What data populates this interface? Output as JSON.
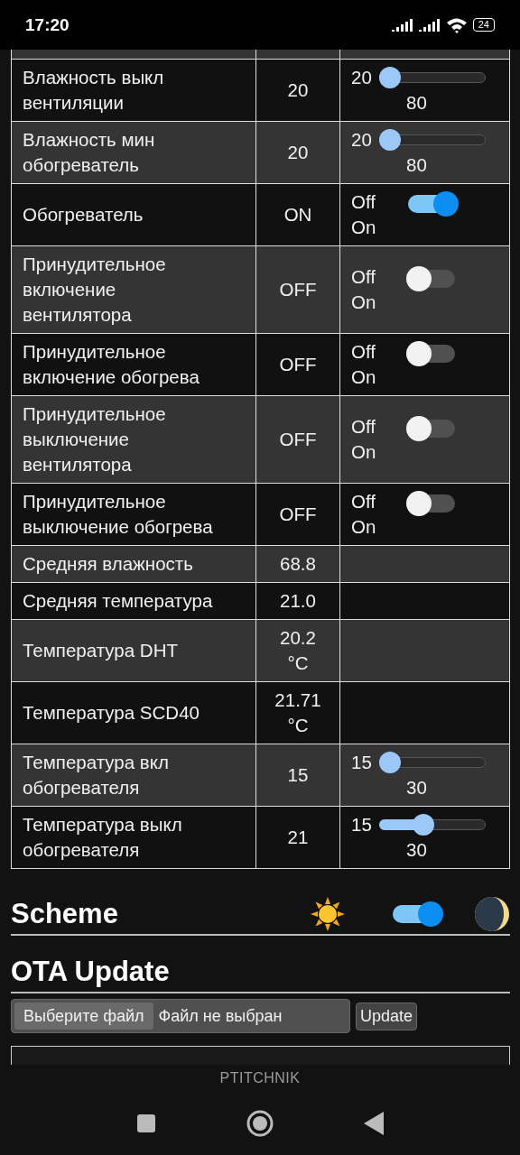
{
  "status_bar": {
    "time": "17:20",
    "battery": "24"
  },
  "table": {
    "rows": [
      {
        "label": "",
        "value": "",
        "control": {
          "kind": "partial"
        }
      },
      {
        "label": "Влажность выкл вентиляции",
        "value": "20",
        "control": {
          "kind": "slider",
          "min": "20",
          "max": "80",
          "level": 0
        }
      },
      {
        "label": "Влажность мин обогреватель",
        "value": "20",
        "control": {
          "kind": "slider",
          "min": "20",
          "max": "80",
          "level": 0
        }
      },
      {
        "label": "Обогреватель",
        "value": "ON",
        "control": {
          "kind": "toggle",
          "off_label": "Off",
          "on_label": "On",
          "on": true
        }
      },
      {
        "label": "Принудительное включение вентилятора",
        "value": "OFF",
        "control": {
          "kind": "toggle",
          "off_label": "Off",
          "on_label": "On",
          "on": false
        }
      },
      {
        "label": "Принудительное включение обогрева",
        "value": "OFF",
        "control": {
          "kind": "toggle",
          "off_label": "Off",
          "on_label": "On",
          "on": false
        }
      },
      {
        "label": "Принудительное выключение вентилятора",
        "value": "OFF",
        "control": {
          "kind": "toggle",
          "off_label": "Off",
          "on_label": "On",
          "on": false
        }
      },
      {
        "label": "Принудительное выключение обогрева",
        "value": "OFF",
        "control": {
          "kind": "toggle",
          "off_label": "Off",
          "on_label": "On",
          "on": false
        }
      },
      {
        "label": "Средняя влажность",
        "value": "68.8",
        "control": {
          "kind": "none"
        }
      },
      {
        "label": "Средняя температура",
        "value": "21.0",
        "control": {
          "kind": "none"
        }
      },
      {
        "label": "Температура DHT",
        "value": "20.2 °C",
        "control": {
          "kind": "none"
        }
      },
      {
        "label": "Температура SCD40",
        "value": "21.71 °C",
        "control": {
          "kind": "none"
        }
      },
      {
        "label": "Температура вкл обогревателя",
        "value": "15",
        "control": {
          "kind": "slider",
          "min": "15",
          "max": "30",
          "level": 0
        }
      },
      {
        "label": "Температура выкл обогревателя",
        "value": "21",
        "control": {
          "kind": "slider",
          "min": "15",
          "max": "30",
          "level": 0.4
        }
      }
    ]
  },
  "scheme": {
    "title": "Scheme",
    "dark": true
  },
  "ota": {
    "title": "OTA Update",
    "file_button": "Выберите файл",
    "file_status": "Файл не выбран",
    "update_button": "Update"
  },
  "nav_bar": {
    "label": "PTITCHNIK"
  }
}
